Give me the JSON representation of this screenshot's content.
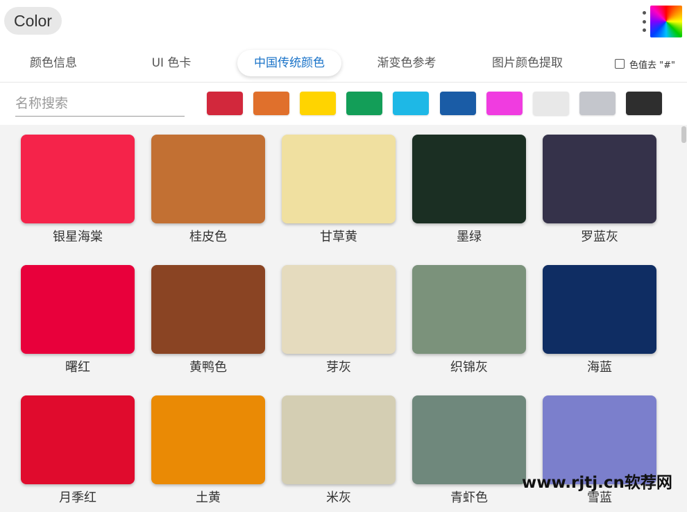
{
  "header": {
    "app_title": "Color",
    "more_icon": "more-vertical-icon",
    "logo_icon": "color-wheel-icon"
  },
  "tabs": [
    {
      "label": "颜色信息",
      "active": false
    },
    {
      "label": "UI 色卡",
      "active": false
    },
    {
      "label": "中国传统颜色",
      "active": true
    },
    {
      "label": "渐变色参考",
      "active": false
    },
    {
      "label": "图片颜色提取",
      "active": false
    }
  ],
  "options": {
    "strip_hash_label": "色值去 \"#\"",
    "strip_hash_checked": false
  },
  "search": {
    "placeholder": "名称搜索",
    "value": ""
  },
  "hue_filters": [
    "#d2283c",
    "#e0702c",
    "#ffd400",
    "#139e58",
    "#1eb8e6",
    "#1a5ca6",
    "#f03ce0",
    "#e8e8e8",
    "#c4c6cc",
    "#2e2e2e"
  ],
  "colors": [
    [
      {
        "name": "银星海棠",
        "color": "#f5234a"
      },
      {
        "name": "桂皮色",
        "color": "#c27033"
      },
      {
        "name": "甘草黄",
        "color": "#f0e0a0"
      },
      {
        "name": "墨绿",
        "color": "#1b2f23"
      },
      {
        "name": "罗蓝灰",
        "color": "#35324a"
      }
    ],
    [
      {
        "name": "曙红",
        "color": "#e8003b"
      },
      {
        "name": "黄鸭色",
        "color": "#8a4423"
      },
      {
        "name": "芽灰",
        "color": "#e5dbbe"
      },
      {
        "name": "织锦灰",
        "color": "#7b927b"
      },
      {
        "name": "海蓝",
        "color": "#0f2d63"
      }
    ],
    [
      {
        "name": "月季红",
        "color": "#e00b2d"
      },
      {
        "name": "土黄",
        "color": "#ea8a05"
      },
      {
        "name": "米灰",
        "color": "#d4ceb3"
      },
      {
        "name": "青虾色",
        "color": "#6f887c"
      },
      {
        "name": "雪蓝",
        "color": "#7b7fcc"
      }
    ]
  ],
  "watermark": "www.rjtj.cn软荐网"
}
